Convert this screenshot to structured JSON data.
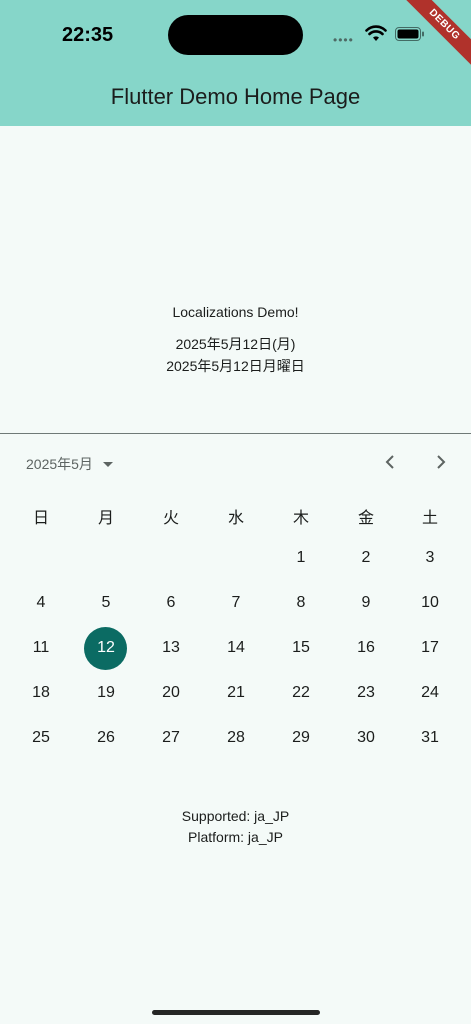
{
  "status_bar": {
    "time": "22:35",
    "dots": "••••"
  },
  "debug_banner": "DEBUG",
  "appbar": {
    "title": "Flutter Demo Home Page"
  },
  "content": {
    "heading": "Localizations Demo!",
    "date_short": "2025年5月12日(月)",
    "date_full": "2025年5月12日月曜日"
  },
  "calendar": {
    "month_label": "2025年5月",
    "weekdays": [
      "日",
      "月",
      "火",
      "水",
      "木",
      "金",
      "土"
    ],
    "weeks": [
      [
        "",
        "",
        "",
        "",
        "1",
        "2",
        "3"
      ],
      [
        "4",
        "5",
        "6",
        "7",
        "8",
        "9",
        "10"
      ],
      [
        "11",
        "12",
        "13",
        "14",
        "15",
        "16",
        "17"
      ],
      [
        "18",
        "19",
        "20",
        "21",
        "22",
        "23",
        "24"
      ],
      [
        "25",
        "26",
        "27",
        "28",
        "29",
        "30",
        "31"
      ]
    ],
    "selected_day": "12"
  },
  "footer": {
    "supported": "Supported: ja_JP",
    "platform": "Platform: ja_JP"
  },
  "colors": {
    "appbar": "#86d6c9",
    "background": "#f4faf8",
    "selected": "#0b6b63",
    "debug": "#b0322b"
  }
}
